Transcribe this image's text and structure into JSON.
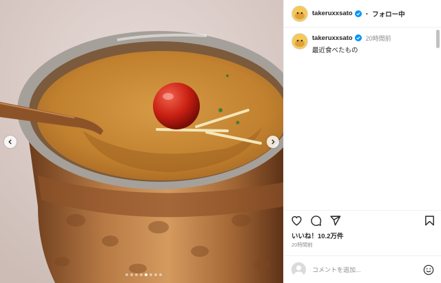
{
  "post": {
    "username": "takeruxxsato",
    "separator": "・",
    "follow_label": "フォロー中",
    "caption": "最近食べたもの",
    "caption_time": "20時間前",
    "likes": "いいね！10.2万件",
    "posted_ago": "20時間前",
    "comment_placeholder": "コメントを追加...",
    "carousel": {
      "count": 8,
      "active": 5
    }
  },
  "colors": {
    "verified": "#0095f6",
    "text": "#262626",
    "muted": "#8e8e8e",
    "curry": "#c78838",
    "copper": "#9a6234",
    "tomato": "#c81f12"
  },
  "icons": [
    "avatar-icon",
    "verified-icon",
    "heart-icon",
    "comment-icon",
    "share-icon",
    "bookmark-icon",
    "emoji-icon",
    "chevron-left-icon",
    "chevron-right-icon"
  ]
}
